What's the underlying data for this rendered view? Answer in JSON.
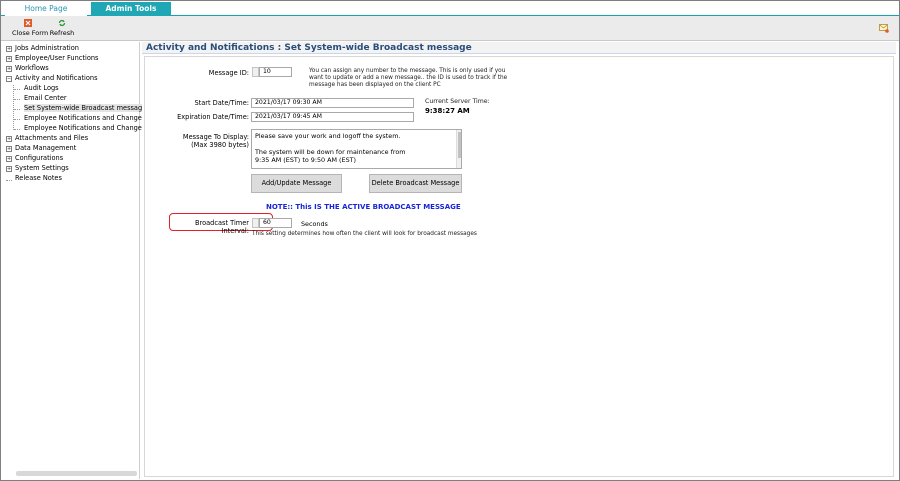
{
  "tabs": [
    {
      "label": "Home Page"
    },
    {
      "label": "Admin Tools"
    }
  ],
  "toolbar": {
    "close_label": "Close Form",
    "refresh_label": "Refresh"
  },
  "tree": {
    "items": [
      {
        "label": "Jobs Administration",
        "expander": "+"
      },
      {
        "label": "Employee/User Functions",
        "expander": "+"
      },
      {
        "label": "Workflows",
        "expander": "+"
      },
      {
        "label": "Activity and Notifications",
        "expander": "−"
      },
      {
        "label": "Audit Logs"
      },
      {
        "label": "Email Center"
      },
      {
        "label": "Set System-wide Broadcast message"
      },
      {
        "label": "Employee Notifications and Change even"
      },
      {
        "label": "Employee Notifications and Change even"
      },
      {
        "label": "Attachments and Files",
        "expander": "+"
      },
      {
        "label": "Data Management",
        "expander": "+"
      },
      {
        "label": "Configurations",
        "expander": "+"
      },
      {
        "label": "System Settings",
        "expander": "+"
      },
      {
        "label": "Release Notes"
      }
    ]
  },
  "main": {
    "title": "Activity and Notifications : Set System-wide Broadcast message",
    "message_id_label": "Message ID:",
    "message_id_value": "10",
    "message_id_help": "You can assign any number to the message. This is only used if you want to update or add a new message.. the ID is used to track if the message has been displayed on the client PC",
    "start_label": "Start Date/Time:",
    "start_value": "2021/03/17 09:30 AM",
    "expiration_label": "Expiration Date/Time:",
    "expiration_value": "2021/03/17 09:45 AM",
    "server_time_label": "Current Server Time:",
    "server_time_value": "9:38:27 AM",
    "message_label": "Message To Display: (Max 3980 bytes)",
    "message_lines": [
      "Please save your work and logoff the system.",
      "",
      "The system will be down for maintenance from",
      "9:35 AM (EST) to 9:50 AM (EST)"
    ],
    "add_update_label": "Add/Update Message",
    "delete_label": "Delete Broadcast Message",
    "note_text": "NOTE:: This IS THE ACTIVE BROADCAST MESSAGE",
    "timer_label": "Broadcast Timer Interval:",
    "timer_value": "60",
    "timer_unit": "Seconds",
    "timer_help": "This setting determines how often the client will look for broadcast messages"
  },
  "colors": {
    "accent_tab": "#1fa7b5",
    "title_text": "#2a4d7a",
    "note_text": "#1a26d6",
    "highlight_border": "#e0212c"
  }
}
